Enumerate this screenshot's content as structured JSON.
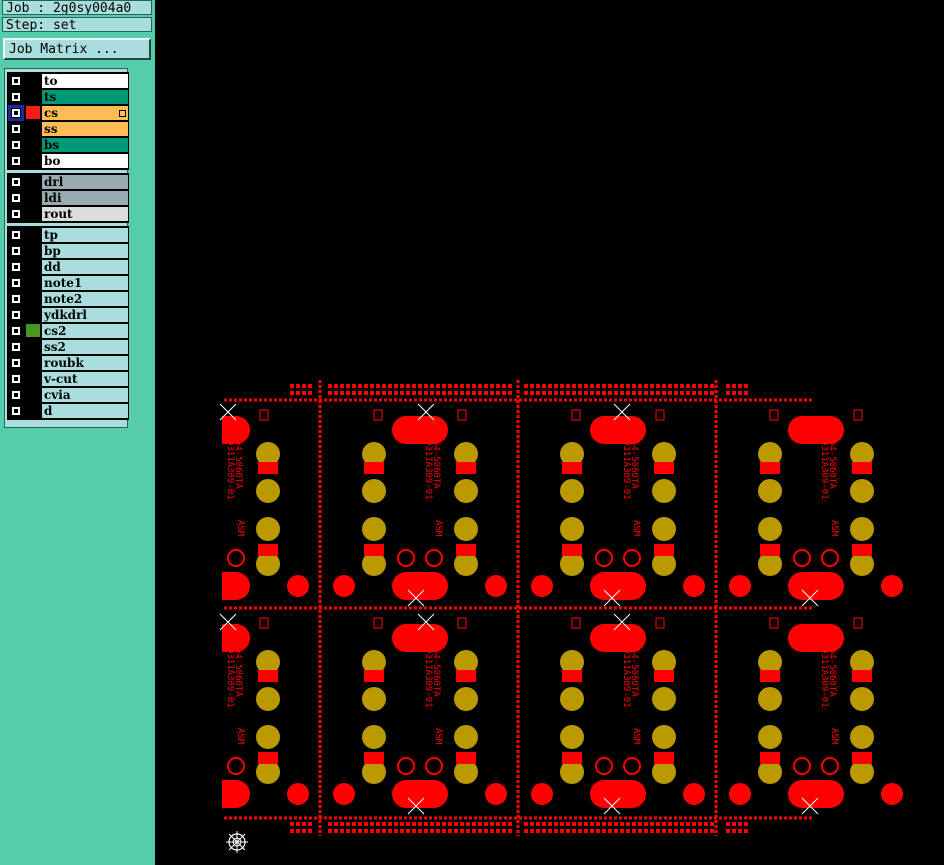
{
  "header": {
    "job": "Job : 2g0sy004a0",
    "step": "Step: set"
  },
  "job_matrix_button": "Job Matrix ...",
  "layer_groups": [
    [
      {
        "name": "to",
        "color": "#ffffff",
        "active_color": null,
        "selected": false
      },
      {
        "name": "ts",
        "color": "#009977",
        "active_color": null,
        "selected": false
      },
      {
        "name": "cs",
        "color": "#ffbb55",
        "active_color": "#ff1a1a",
        "selected": true
      },
      {
        "name": "ss",
        "color": "#ffbb55",
        "active_color": null,
        "selected": false
      },
      {
        "name": "bs",
        "color": "#009977",
        "active_color": null,
        "selected": false
      },
      {
        "name": "bo",
        "color": "#ffffff",
        "active_color": null,
        "selected": false
      }
    ],
    [
      {
        "name": "drl",
        "color": "#99aab0",
        "active_color": null,
        "selected": false
      },
      {
        "name": "ldi",
        "color": "#99aab0",
        "active_color": null,
        "selected": false
      },
      {
        "name": "rout",
        "color": "#dddddd",
        "active_color": null,
        "selected": false
      }
    ],
    [
      {
        "name": "tp",
        "color": "#aadddd",
        "active_color": null,
        "selected": false
      },
      {
        "name": "bp",
        "color": "#aadddd",
        "active_color": null,
        "selected": false
      },
      {
        "name": "dd",
        "color": "#aadddd",
        "active_color": null,
        "selected": false
      },
      {
        "name": "note1",
        "color": "#aadddd",
        "active_color": null,
        "selected": false
      },
      {
        "name": "note2",
        "color": "#aadddd",
        "active_color": null,
        "selected": false
      },
      {
        "name": "ydkdrl",
        "color": "#aadddd",
        "active_color": null,
        "selected": false
      },
      {
        "name": "cs2",
        "color": "#aadddd",
        "active_color": "#449922",
        "selected": false
      },
      {
        "name": "ss2",
        "color": "#aadddd",
        "active_color": null,
        "selected": false
      },
      {
        "name": "roubk",
        "color": "#aadddd",
        "active_color": null,
        "selected": false
      },
      {
        "name": "v-cut",
        "color": "#aadddd",
        "active_color": null,
        "selected": false
      },
      {
        "name": "cvia",
        "color": "#aadddd",
        "active_color": null,
        "selected": false
      },
      {
        "name": "d",
        "color": "#aadddd",
        "active_color": null,
        "selected": false
      }
    ]
  ],
  "board": {
    "copper_color": "#ff0000",
    "pad_color": "#bb9900",
    "label_part": "0311A309-01",
    "label_code": "64-5060TA",
    "label_asm": "ASM"
  }
}
